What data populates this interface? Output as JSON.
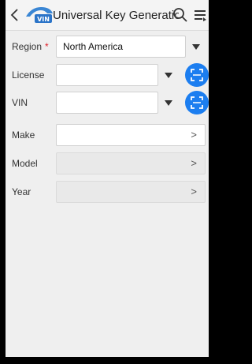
{
  "header": {
    "back_icon": "chevron-left-icon",
    "logo_text": "VIN",
    "title": "Universal Key Generation",
    "search_icon": "search-icon",
    "menu_icon": "menu-lines-icon"
  },
  "form": {
    "region": {
      "label": "Region",
      "required_mark": "*",
      "value": "North America"
    },
    "license": {
      "label": "License",
      "value": "",
      "scan_icon": "scan-icon"
    },
    "vin": {
      "label": "VIN",
      "value": "",
      "scan_icon": "scan-icon"
    },
    "make": {
      "label": "Make",
      "value": "",
      "chevron": ">"
    },
    "model": {
      "label": "Model",
      "value": "",
      "chevron": ">"
    },
    "year": {
      "label": "Year",
      "value": "",
      "chevron": ">"
    }
  },
  "colors": {
    "accent": "#1c7ef0",
    "required": "#e0202a",
    "background": "#efefef"
  }
}
